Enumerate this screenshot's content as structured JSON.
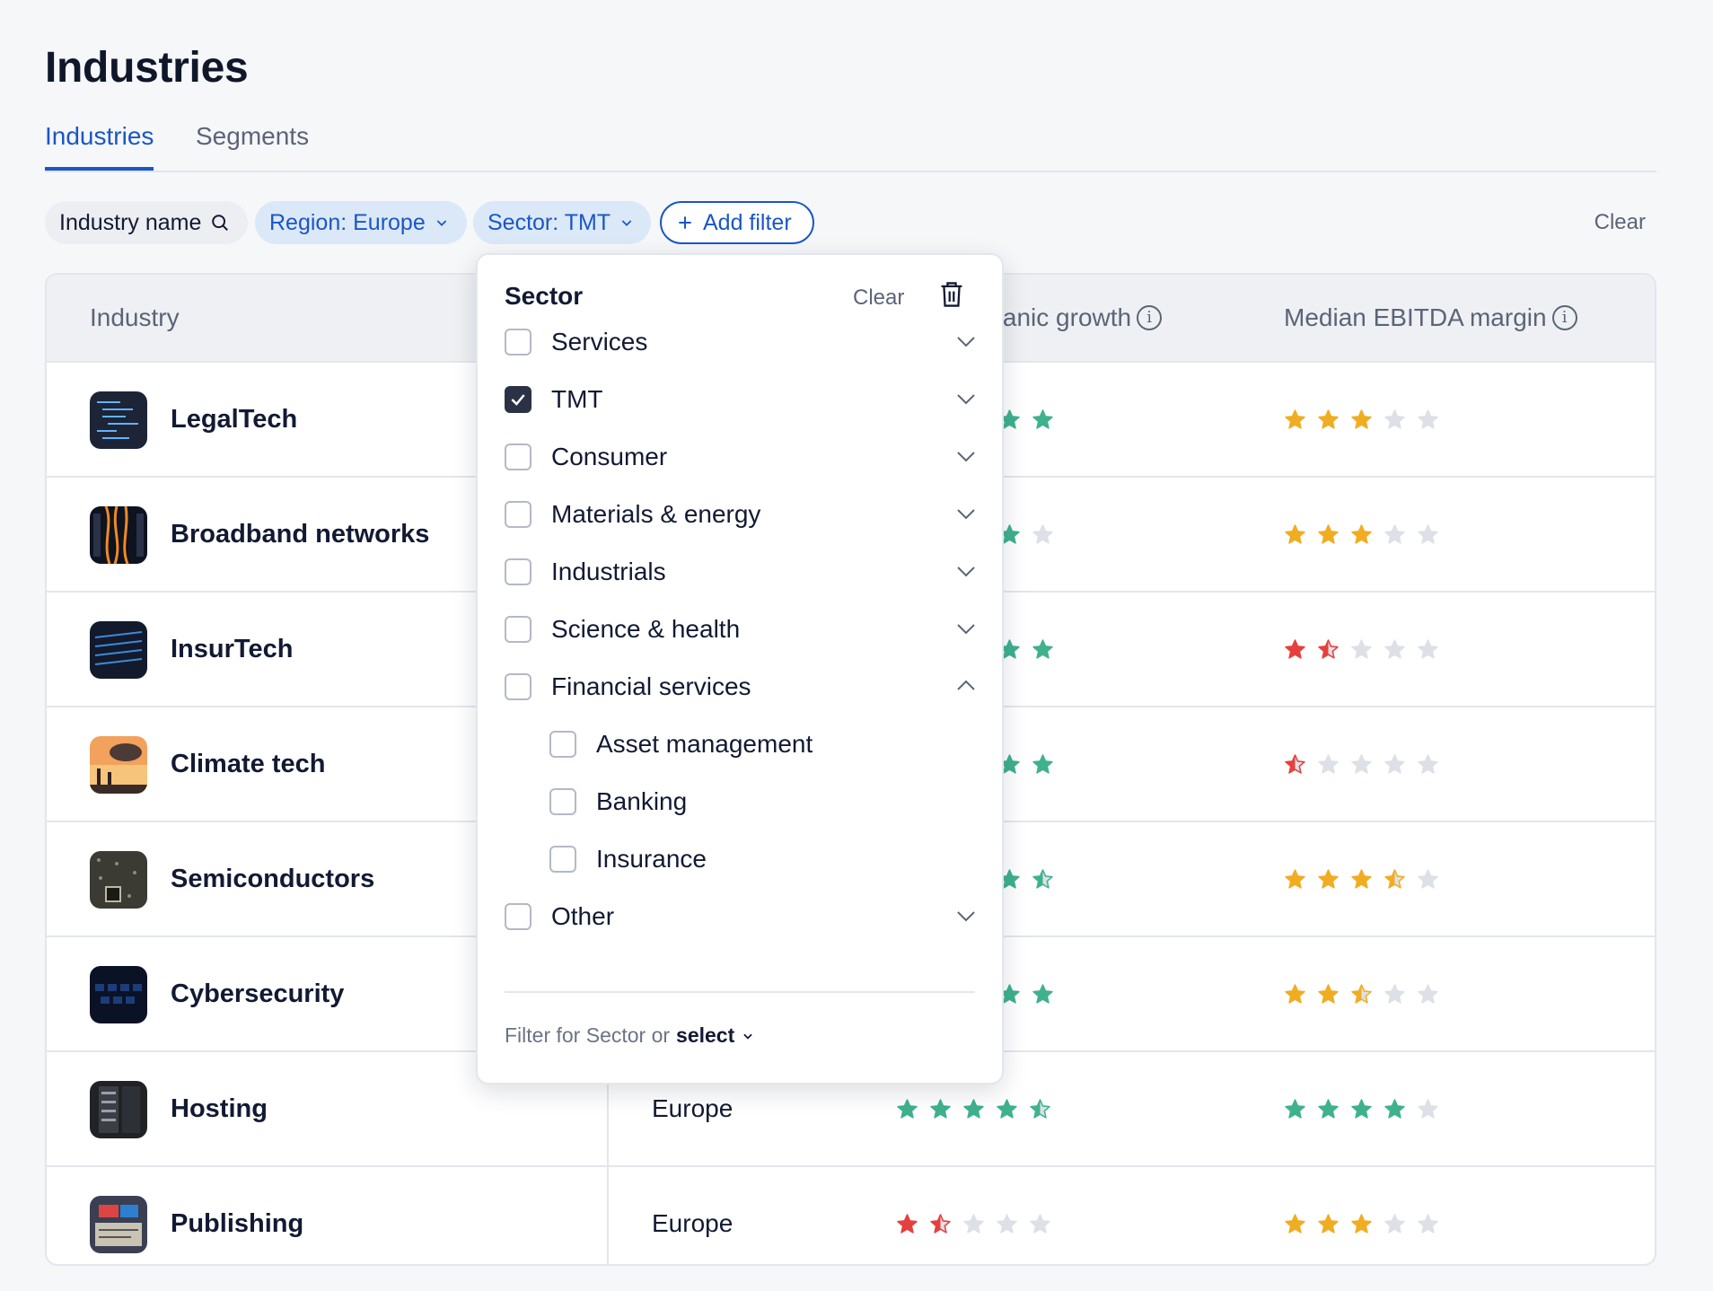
{
  "page": {
    "title": "Industries"
  },
  "tabs": [
    {
      "label": "Industries",
      "active": true
    },
    {
      "label": "Segments",
      "active": false
    }
  ],
  "filters": {
    "search_label": "Industry name",
    "region_label": "Region: Europe",
    "sector_label": "Sector: TMT",
    "add_label": "Add filter",
    "clear_label": "Clear"
  },
  "table": {
    "columns": [
      {
        "label": "Industry"
      },
      {
        "label": "rganic growth"
      },
      {
        "label": "Median EBITDA margin"
      }
    ],
    "rows": [
      {
        "name": "LegalTech",
        "region": "",
        "growth_rating": null,
        "growth_color": "#3fb18f",
        "margin_rating": 3,
        "margin_color": "#f0ad22",
        "thumb": "code"
      },
      {
        "name": "Broadband networks",
        "region": "",
        "growth_rating": null,
        "growth_color": "#3fb18f",
        "margin_rating": 3,
        "margin_color": "#f0ad22",
        "thumb": "cables"
      },
      {
        "name": "InsurTech",
        "region": "",
        "growth_rating": null,
        "growth_color": "#3fb18f",
        "margin_rating": 1.5,
        "margin_color": "#e5403d",
        "thumb": "laptop"
      },
      {
        "name": "Climate tech",
        "region": "",
        "growth_rating": null,
        "growth_color": "#3fb18f",
        "margin_rating": 0.5,
        "margin_color": "#e5403d",
        "thumb": "smoke"
      },
      {
        "name": "Semiconductors",
        "region": "",
        "growth_rating": null,
        "growth_color": "#3fb18f",
        "margin_rating": 3.5,
        "margin_color": "#f0ad22",
        "thumb": "chip"
      },
      {
        "name": "Cybersecurity",
        "region": "",
        "growth_rating": null,
        "growth_color": "#3fb18f",
        "margin_rating": 2.5,
        "margin_color": "#f0ad22",
        "thumb": "keyboard"
      },
      {
        "name": "Hosting",
        "region": "Europe",
        "growth_rating": 4.5,
        "growth_color": "#3fb18f",
        "margin_rating": 4,
        "margin_color": "#3fb18f",
        "thumb": "server"
      },
      {
        "name": "Publishing",
        "region": "Europe",
        "growth_rating": 1.5,
        "growth_color": "#e5403d",
        "margin_rating": 3,
        "margin_color": "#f0ad22",
        "thumb": "print"
      }
    ],
    "partial_growth_visible": [
      [
        1,
        1
      ],
      [
        1,
        0
      ],
      [
        1,
        1
      ],
      [
        1,
        1
      ],
      [
        1,
        0.5
      ],
      [
        1,
        1
      ]
    ]
  },
  "dropdown": {
    "title": "Sector",
    "clear_label": "Clear",
    "options": [
      {
        "label": "Services",
        "checked": false,
        "expanded": false
      },
      {
        "label": "TMT",
        "checked": true,
        "expanded": false
      },
      {
        "label": "Consumer",
        "checked": false,
        "expanded": false
      },
      {
        "label": "Materials & energy",
        "checked": false,
        "expanded": false
      },
      {
        "label": "Industrials",
        "checked": false,
        "expanded": false
      },
      {
        "label": "Science & health",
        "checked": false,
        "expanded": false
      },
      {
        "label": "Financial services",
        "checked": false,
        "expanded": true
      },
      {
        "label": "Other",
        "checked": false,
        "expanded": false
      }
    ],
    "sub_options": [
      {
        "label": "Asset management",
        "checked": false
      },
      {
        "label": "Banking",
        "checked": false
      },
      {
        "label": "Insurance",
        "checked": false
      }
    ],
    "footer_text": "Filter for Sector or",
    "footer_select": "select"
  },
  "colors": {
    "accent": "#1a56c7",
    "star_empty": "#dde0e6"
  }
}
